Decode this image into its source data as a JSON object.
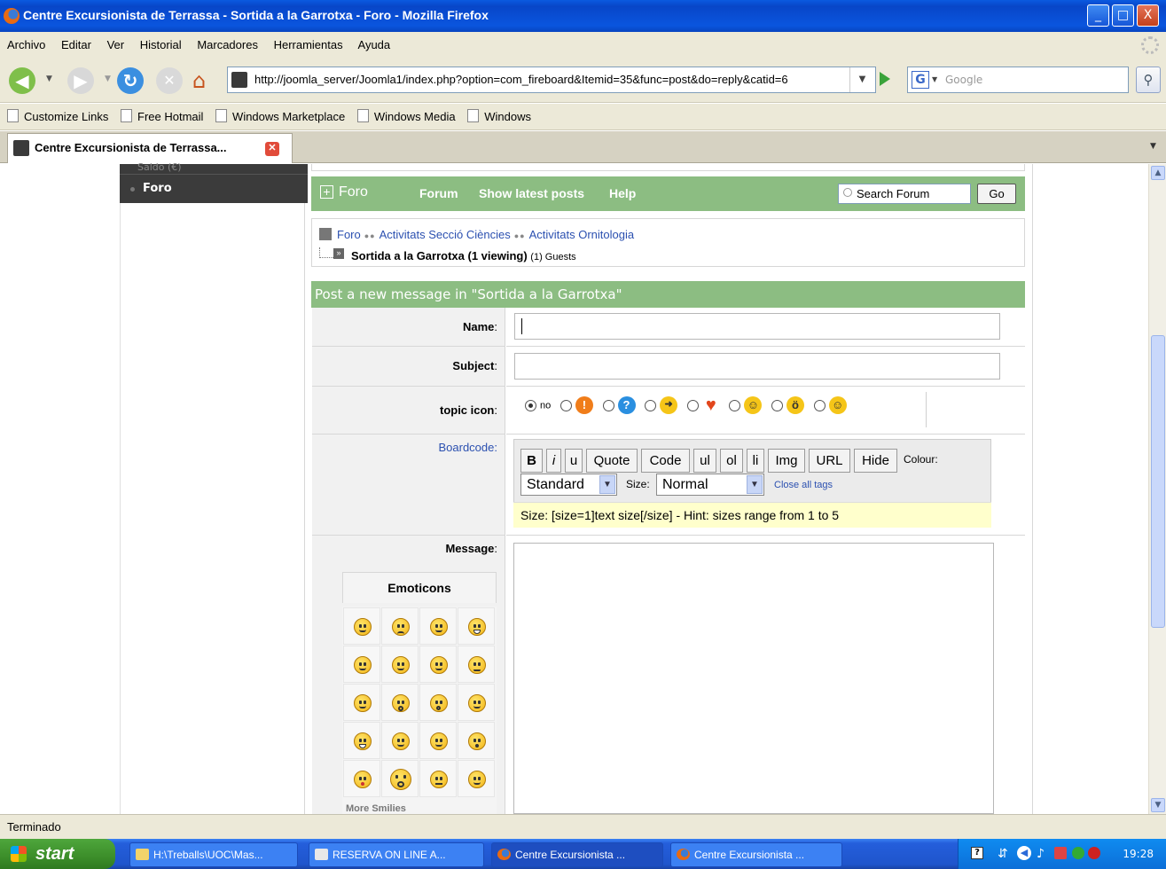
{
  "window": {
    "title": "Centre Excursionista de Terrassa - Sortida a la Garrotxa - Foro - Mozilla Firefox",
    "controls": [
      "_",
      "□",
      "X"
    ]
  },
  "menu": [
    "Archivo",
    "Editar",
    "Ver",
    "Historial",
    "Marcadores",
    "Herramientas",
    "Ayuda"
  ],
  "nav": {
    "url": "http://joomla_server/Joomla1/index.php?option=com_fireboard&Itemid=35&func=post&do=reply&catid=6",
    "search_placeholder": "Google",
    "search_engine_icon": "G"
  },
  "bookmarks": [
    "Customize Links",
    "Free Hotmail",
    "Windows Marketplace",
    "Windows Media",
    "Windows"
  ],
  "tab": {
    "title": "Centre Excursionista de Terrassa..."
  },
  "status": "Terminado",
  "taskbar": {
    "start": "start",
    "items": [
      {
        "label": "H:\\Treballs\\UOC\\Mas...",
        "icon": "folder-icon"
      },
      {
        "label": "RESERVA ON LINE A...",
        "icon": "document-icon"
      },
      {
        "label": "Centre Excursionista ...",
        "icon": "firefox-icon"
      },
      {
        "label": "Centre Excursionista ...",
        "icon": "firefox-icon"
      }
    ],
    "clock": "19:28"
  },
  "sidebar": {
    "partial_item": "Saldo (€)",
    "item": "Foro"
  },
  "forum": {
    "logo_text": "Foro",
    "links": [
      "Forum",
      "Show latest posts",
      "Help"
    ],
    "search_placeholder": "Search Forum",
    "go": "Go",
    "breadcrumb": [
      "Foro",
      "Activitats Secció Ciències",
      "Activitats Ornitologia"
    ],
    "topic": "Sortida a la Garrotxa (1 viewing)",
    "guests": "(1) Guests",
    "post_header": "Post a new message in \"Sortida a la Garrotxa\""
  },
  "form": {
    "name_label": "Name",
    "subject_label": "Subject",
    "topic_icon_label": "topic icon",
    "topic_icon_none": "no",
    "boardcode_label": "Boardcode",
    "message_label": "Message",
    "colon": ":",
    "buttons": [
      "B",
      "i",
      "u",
      "Quote",
      "Code",
      "ul",
      "ol",
      "li",
      "Img",
      "URL",
      "Hide"
    ],
    "colour_label": "Colour:",
    "colour_value": "Standard",
    "size_label": "Size:",
    "size_value": "Normal",
    "close_tags": "Close all tags",
    "hint": "Size: [size=1]text size[/size] - Hint: sizes range from 1 to 5"
  },
  "emoticons": {
    "header": "Emoticons",
    "more_label": "More Smilies"
  },
  "colors": {
    "forum_green": "#8cbd82",
    "link_blue": "#2b50b0",
    "hint_yellow": "#ffffcc",
    "xp_blue": "#0a55de"
  }
}
